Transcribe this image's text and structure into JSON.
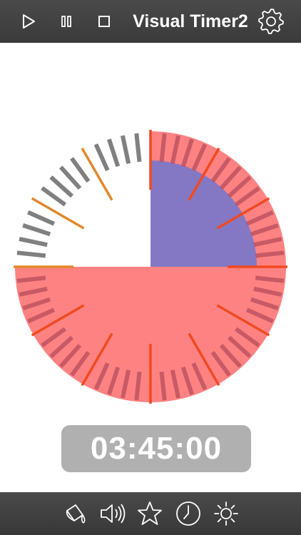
{
  "header": {
    "title": "Visual Timer2",
    "buttons": [
      {
        "name": "play-icon"
      },
      {
        "name": "pause-icon"
      },
      {
        "name": "stop-icon"
      },
      {
        "name": "gear-icon"
      }
    ]
  },
  "timer": {
    "display": "03:45:00",
    "dial_range_minutes": 60,
    "remaining_fraction": 0.75,
    "elapsed_marker_fraction": 0.125,
    "colors": {
      "remaining_fill": "#ff8282",
      "inner_fill": "#8478c4",
      "tick_gray": "#808080",
      "tick_dark": "#b04a5a",
      "tick_orange": "#e0882c",
      "tick_red": "#f04a20"
    }
  },
  "footer": {
    "buttons": [
      {
        "name": "paint-bucket-icon"
      },
      {
        "name": "speaker-icon"
      },
      {
        "name": "star-icon"
      },
      {
        "name": "clock-icon"
      },
      {
        "name": "brightness-icon"
      }
    ]
  }
}
